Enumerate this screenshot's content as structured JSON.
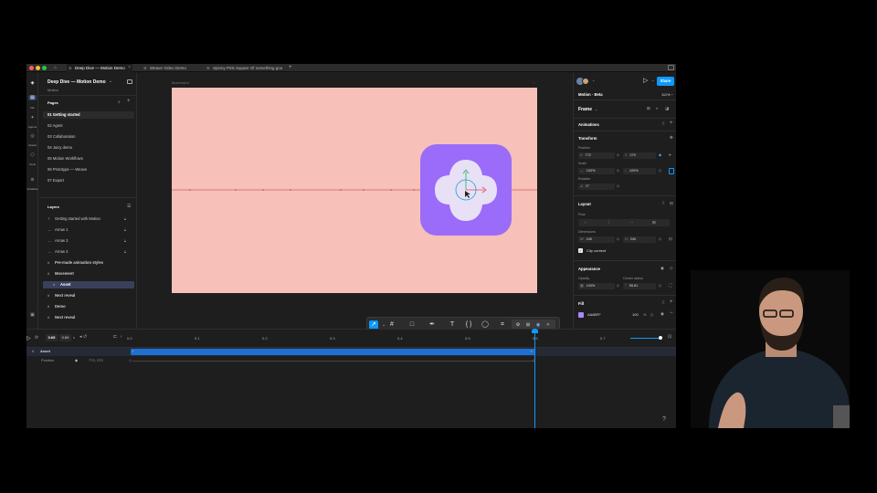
{
  "tabs": {
    "active": "Deep Dive — Motion Demo",
    "second": "Weave Video Demo",
    "third": "Spinny Pink Square Of something goo",
    "add": "+"
  },
  "file": {
    "name": "Deep Dive — Motion Demo",
    "project": "Motion"
  },
  "rail": {
    "file": "File",
    "agent": "Agents",
    "assets": "Assets",
    "tools": "Tools",
    "variables": "Variables"
  },
  "pages": {
    "title": "Pages",
    "items": [
      "01 Getting started",
      "02 Agent",
      "03 Collaboration",
      "04 Juicy demo",
      "05 Motion Workflows",
      "06 Prototype — Weave",
      "07 Export"
    ]
  },
  "layers": {
    "title": "Layers",
    "items": [
      {
        "label": "Getting started with Motion",
        "icon": "T"
      },
      {
        "label": "Arrow 1",
        "icon": "—"
      },
      {
        "label": "Arrow 3",
        "icon": "—"
      },
      {
        "label": "Arrow 4",
        "icon": "—"
      },
      {
        "label": "Pre-made animation styles",
        "icon": "#"
      },
      {
        "label": "Movement",
        "icon": "#"
      },
      {
        "label": "Asset",
        "icon": "#"
      },
      {
        "label": "Next reveal",
        "icon": "#"
      },
      {
        "label": "Demo",
        "icon": "#"
      },
      {
        "label": "Next reveal",
        "icon": "#"
      }
    ]
  },
  "canvas": {
    "frame_label": "Movement",
    "frame_color": "#f7c0b8",
    "asset_color": "#9b6bfa",
    "blob_color": "#e8e0f5"
  },
  "panel": {
    "mode": "Motion · Beta",
    "zoom": "111%",
    "share": "Share",
    "frame": "Frame",
    "animations": "Animations",
    "transform": "Transform",
    "position_label": "Position",
    "pos_x_prefix": "X",
    "pos_x": "772",
    "pos_y_prefix": "Y",
    "pos_y": "270",
    "scale_label": "Scale",
    "scale_x": "100%",
    "scale_y": "100%",
    "rotation_label": "Rotation",
    "rotation": "0°",
    "layout": "Layout",
    "flow_label": "Flow",
    "dimensions_label": "Dimensions",
    "width_prefix": "W",
    "width": "240",
    "height_prefix": "H",
    "height": "240",
    "clip": "Clip content",
    "appearance": "Appearance",
    "opacity_label": "Opacity",
    "opacity": "100%",
    "radius_label": "Corner radius",
    "radius": "55.81",
    "fill": "Fill",
    "fill_hex": "AA88FF",
    "fill_opacity": "100",
    "fill_pct": "%",
    "fill_color": "#aa88ff",
    "accent": "#0d99ff"
  },
  "timeline": {
    "time_current": "0.69",
    "time_total": "0.69",
    "time_unit": "s",
    "ticks": [
      "0.0",
      "0.1",
      "0.2",
      "0.3",
      "0.4",
      "0.5",
      "0.6",
      "0.7"
    ],
    "track_name": "Asset",
    "property": "Position",
    "property_value": "772, 270",
    "help": "?",
    "track_color": "#1f6fd1"
  }
}
